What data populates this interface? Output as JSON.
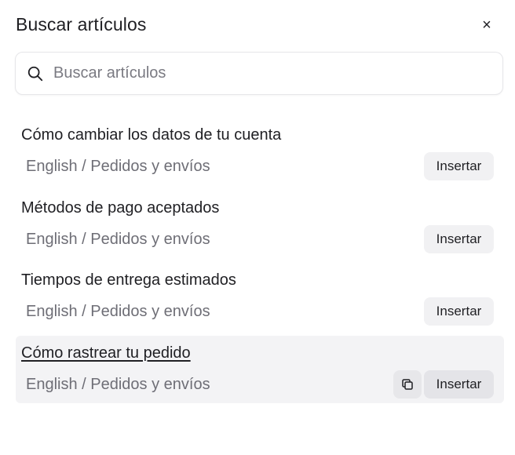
{
  "header": {
    "title": "Buscar artículos",
    "close_icon": "close-icon",
    "close_glyph": "×"
  },
  "search": {
    "placeholder": "Buscar artículos",
    "value": "",
    "icon": "search-icon"
  },
  "results": [
    {
      "title": "Cómo cambiar los datos de tu cuenta",
      "path": "English / Pedidos y envíos",
      "insert_label": "Insertar"
    },
    {
      "title": "Métodos de pago aceptados",
      "path": "English / Pedidos y envíos",
      "insert_label": "Insertar"
    },
    {
      "title": "Tiempos de entrega estimados",
      "path": "English / Pedidos y envíos",
      "insert_label": "Insertar"
    },
    {
      "title": "Cómo rastrear tu pedido",
      "path": "English / Pedidos y envíos",
      "insert_label": "Insertar",
      "hovered": true,
      "copy_icon": "copy-icon"
    }
  ],
  "colors": {
    "text": "#1f1f23",
    "muted": "#6e6e76",
    "button_bg": "#f1f1f3",
    "hover_bg": "#f3f3f5",
    "border": "#e6e6e9"
  }
}
